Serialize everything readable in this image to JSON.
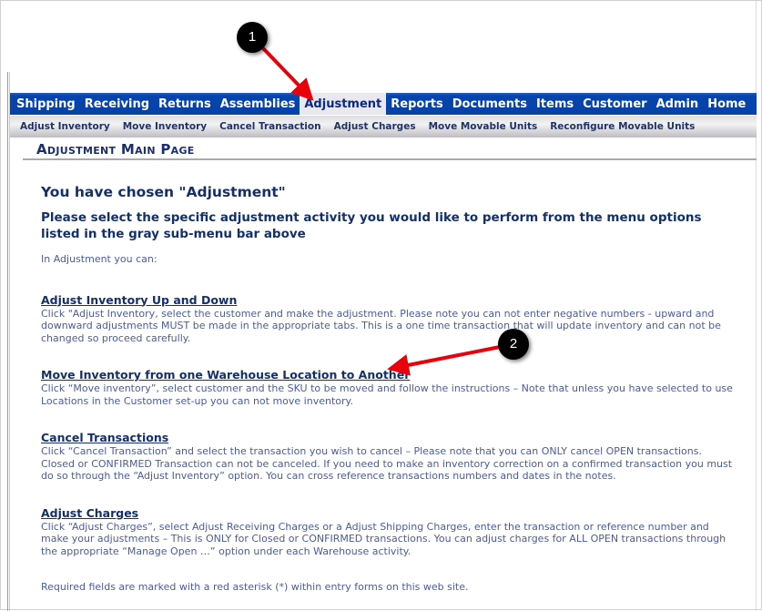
{
  "nav": {
    "items": [
      "Shipping",
      "Receiving",
      "Returns",
      "Assemblies",
      "Adjustment",
      "Reports",
      "Documents",
      "Items",
      "Customer",
      "Admin",
      "Home"
    ],
    "active": "Adjustment"
  },
  "submenu": {
    "items": [
      "Adjust Inventory",
      "Move Inventory",
      "Cancel Transaction",
      "Adjust Charges",
      "Move Movable Units",
      "Reconfigure Movable Units"
    ]
  },
  "page_title": "Adjustment Main Page",
  "heading": "You have chosen \"Adjustment\"",
  "subheading": "Please select the specific adjustment activity you would like to perform from the menu options listed in the gray sub-menu bar above",
  "intro": "In Adjustment you can:",
  "sections": [
    {
      "title": "Adjust Inventory Up and Down",
      "text": "Click \"Adjust Inventory, select the customer and make the adjustment. Please note you can not enter negative numbers - upward and downward adjustments MUST be made in the appropriate tabs. This is a one time transaction that will update inventory and can not be changed so proceed carefully."
    },
    {
      "title": "Move Inventory from one Warehouse Location to Another",
      "text": "Click “Move inventory”, select customer and the SKU to be moved and follow the instructions – Note that unless you have selected to use Locations in the Customer set-up you can not move inventory."
    },
    {
      "title": "Cancel Transactions",
      "text": "Click “Cancel Transaction” and select the transaction you wish to cancel – Please note that you can ONLY cancel OPEN transactions. Closed or CONFIRMED Transaction can not be canceled. If you need to make an inventory correction on a confirmed transaction you must do so through the “Adjust Inventory” option. You can cross reference transactions numbers and dates in the notes."
    },
    {
      "title": "Adjust Charges",
      "text": "Click “Adjust Charges”, select Adjust Receiving Charges or a Adjust Shipping Charges, enter the transaction or reference number and make your adjustments – This is ONLY for Closed or CONFIRMED transactions. You can adjust charges for ALL OPEN transactions through the appropriate “Manage Open …” option under each Warehouse activity."
    }
  ],
  "footer": "Required fields are marked with a red asterisk (*) within entry forms on this web site.",
  "annotations": [
    "1",
    "2"
  ],
  "colors": {
    "nav": "#0645ad",
    "arrow": "#e8000b"
  }
}
